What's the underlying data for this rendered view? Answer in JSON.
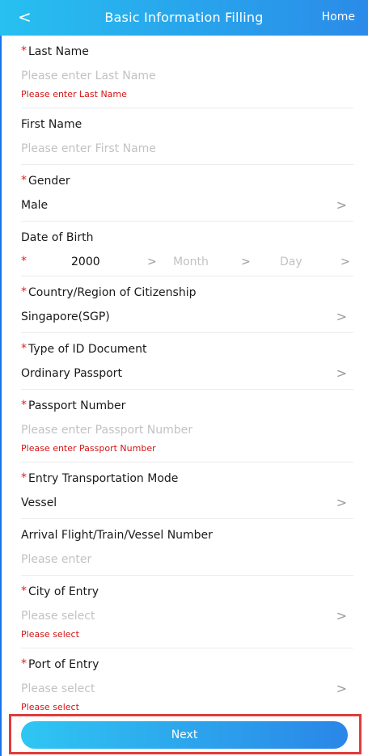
{
  "nav": {
    "back_icon": "<",
    "title": "Basic Information Filling",
    "home_label": "Home"
  },
  "required_mark": "*",
  "form": {
    "last_name": {
      "label": "Last Name",
      "placeholder": "Please enter Last Name",
      "error": "Please enter Last Name"
    },
    "first_name": {
      "label": "First Name",
      "placeholder": "Please enter First Name"
    },
    "gender": {
      "label": "Gender",
      "value": "Male"
    },
    "dob": {
      "label": "Date of Birth",
      "year": "2000",
      "month": "Month",
      "day": "Day"
    },
    "citizenship": {
      "label": "Country/Region of Citizenship",
      "value": "Singapore(SGP)"
    },
    "id_doc_type": {
      "label": "Type of ID Document",
      "value": "Ordinary Passport"
    },
    "passport": {
      "label": "Passport Number",
      "placeholder": "Please enter Passport Number",
      "error": "Please enter Passport Number"
    },
    "entry_mode": {
      "label": "Entry Transportation Mode",
      "value": "Vessel"
    },
    "arrival_number": {
      "label": "Arrival Flight/Train/Vessel Number",
      "placeholder": "Please enter"
    },
    "city_entry": {
      "label": "City of Entry",
      "placeholder": "Please select",
      "error": "Please select"
    },
    "port_entry": {
      "label": "Port of Entry",
      "placeholder": "Please select",
      "error": "Please select"
    }
  },
  "chevron": ">",
  "next_label": "Next",
  "colors": {
    "nav_gradient_start": "#27c0f0",
    "nav_gradient_end": "#2a8be8",
    "required": "#e02020",
    "error": "#d41414",
    "highlight_border": "#e33b3b"
  }
}
